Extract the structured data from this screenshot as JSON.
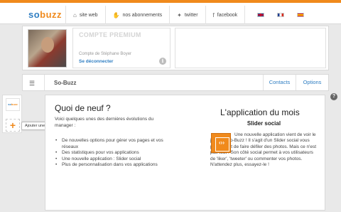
{
  "colors": {
    "brand_orange": "#f08a1c",
    "link_blue": "#2f7ec2"
  },
  "header": {
    "logo": {
      "part1": "so",
      "part2": "buzz"
    },
    "nav": [
      {
        "label": "site web",
        "icon": "home-icon"
      },
      {
        "label": "nos abonnements",
        "icon": "thumbs-up-icon"
      },
      {
        "label": "twitter",
        "icon": "twitter-icon"
      },
      {
        "label": "facebook",
        "icon": "facebook-icon"
      }
    ],
    "languages": [
      "uk-flag-icon",
      "france-flag-icon",
      "spain-flag-icon"
    ]
  },
  "profile": {
    "plan": "COMPTE PREMIUM",
    "account_of": "Compte de Stéphane Boyer",
    "logout": "Se déconnecter"
  },
  "toolbar": {
    "title": "So-Buzz",
    "tabs": [
      "Contacts",
      "Options"
    ]
  },
  "sidebar": {
    "app_label": {
      "part1": "so",
      "part2": "buzz"
    },
    "add_symbol": "+",
    "add_tooltip": "Ajouter une page"
  },
  "main": {
    "news_title": "Quoi de neuf ?",
    "news_intro": "Voici quelques unes des dernières évolutions du manager :",
    "news_items": [
      "De nouvelles options pour gérer vos pages et vos réseaux",
      "Des statistiques pour vos applications",
      "Une nouvelle application : Slider social",
      "Plus de personnalisation dans vos applications"
    ],
    "app_of_month_title": "L'application du mois",
    "app_name": "Slider social",
    "app_description": "Une nouvelle application vient de voir le jour sur So-Buzz ! Il s'agit d'un Slider social vous permettant de faire défiler des photos. Mais ce n'est pas tout ! Son côté social permet à vos utilisateurs de 'liker', 'tweeter' ou commenter vos photos. N'attendez plus, essayez-le !"
  }
}
